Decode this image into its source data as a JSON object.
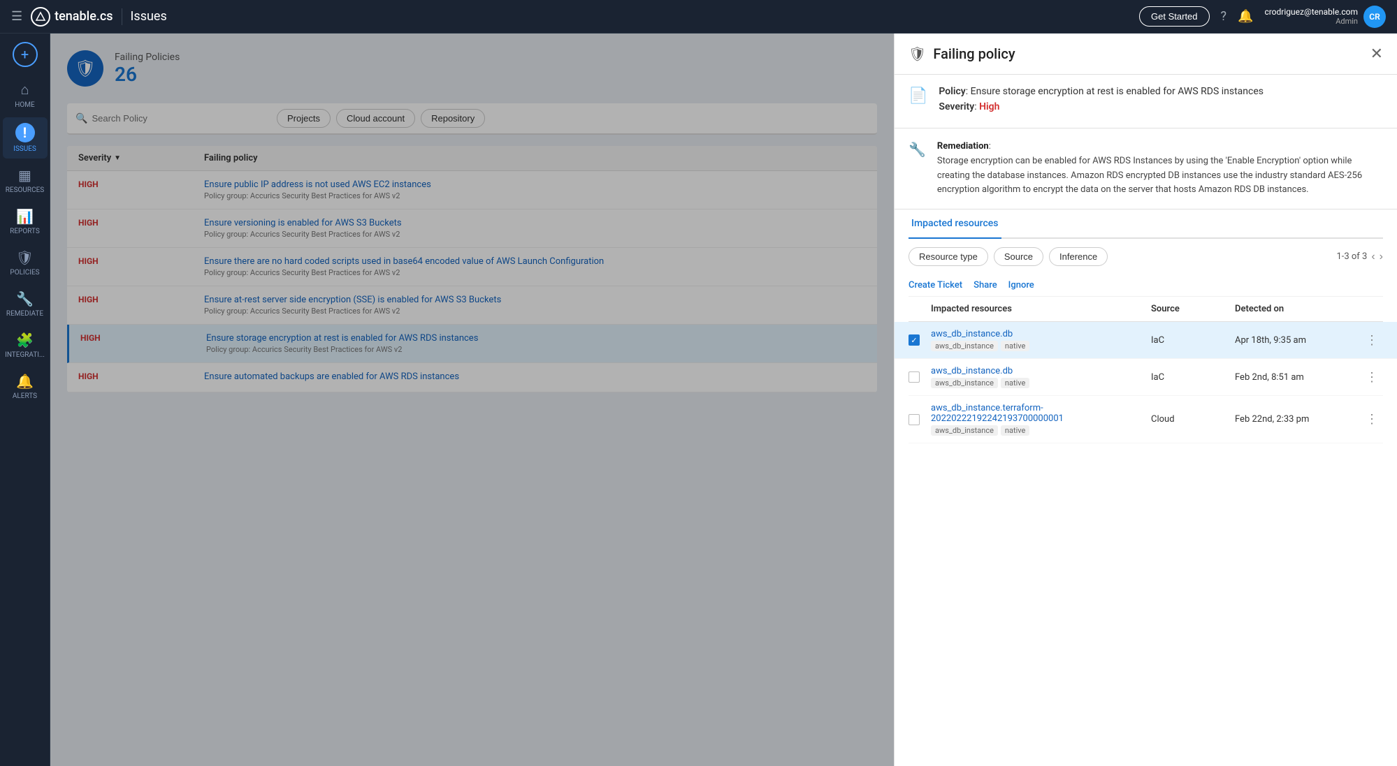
{
  "navbar": {
    "logo_text": "tenable.cs",
    "page_title": "Issues",
    "get_started": "Get Started",
    "user_email": "crodriguez@tenable.com",
    "user_role": "Admin",
    "user_initials": "CR"
  },
  "sidebar": {
    "add_icon": "+",
    "items": [
      {
        "id": "home",
        "label": "HOME",
        "icon": "⌂"
      },
      {
        "id": "issues",
        "label": "ISSUES",
        "icon": "!",
        "active": true
      },
      {
        "id": "resources",
        "label": "RESOURCES",
        "icon": "▦"
      },
      {
        "id": "reports",
        "label": "REPORTS",
        "icon": "⚙"
      },
      {
        "id": "policies",
        "label": "POLICIES",
        "icon": "🛡"
      },
      {
        "id": "remediate",
        "label": "REMEDIATE",
        "icon": "🔧"
      },
      {
        "id": "integrations",
        "label": "INTEGRATI...",
        "icon": "🧩"
      },
      {
        "id": "alerts",
        "label": "ALERTS",
        "icon": "🔔"
      }
    ]
  },
  "issues_page": {
    "header": {
      "title": "Failing Policies",
      "count": "26"
    },
    "search_placeholder": "Search Policy",
    "filters": [
      "Projects",
      "Cloud account",
      "Repository"
    ],
    "table": {
      "columns": [
        "Severity",
        "Failing policy"
      ],
      "rows": [
        {
          "severity": "HIGH",
          "policy_name": "Ensure public IP address is not used AWS EC2 instances",
          "policy_group": "Policy group: Accurics Security Best Practices for AWS v2",
          "selected": false
        },
        {
          "severity": "HIGH",
          "policy_name": "Ensure versioning is enabled for AWS S3 Buckets",
          "policy_group": "Policy group: Accurics Security Best Practices for AWS v2",
          "selected": false
        },
        {
          "severity": "HIGH",
          "policy_name": "Ensure there are no hard coded scripts used in base64 encoded value of AWS Launch Configuration",
          "policy_group": "Policy group: Accurics Security Best Practices for AWS v2",
          "selected": false
        },
        {
          "severity": "HIGH",
          "policy_name": "Ensure at-rest server side encryption (SSE) is enabled for AWS S3 Buckets",
          "policy_group": "Policy group: Accurics Security Best Practices for AWS v2",
          "selected": false
        },
        {
          "severity": "HIGH",
          "policy_name": "Ensure storage encryption at rest is enabled for AWS RDS instances",
          "policy_group": "Policy group: Accurics Security Best Practices for AWS v2",
          "selected": true
        },
        {
          "severity": "HIGH",
          "policy_name": "Ensure automated backups are enabled for AWS RDS instances",
          "policy_group": "",
          "selected": false
        }
      ]
    }
  },
  "right_panel": {
    "title": "Failing policy",
    "policy_label": "Policy",
    "policy_text": "Ensure storage encryption at rest is enabled for AWS RDS instances",
    "severity_label": "Severity",
    "severity_value": "High",
    "remediation_title": "Remediation",
    "remediation_body": "Storage encryption can be enabled for AWS RDS Instances by using the 'Enable Encryption' option while creating the database instances. Amazon RDS encrypted DB instances use the industry standard AES-256 encryption algorithm to encrypt the data on the server that hosts Amazon RDS DB instances.",
    "tabs": [
      {
        "id": "impacted",
        "label": "Impacted resources",
        "active": true
      }
    ],
    "filter_buttons": [
      "Resource type",
      "Source",
      "Inference"
    ],
    "pagination": "1-3 of 3",
    "action_links": [
      "Create Ticket",
      "Share",
      "Ignore"
    ],
    "table": {
      "columns": [
        "",
        "Impacted resources",
        "Source",
        "Detected on",
        ""
      ],
      "rows": [
        {
          "checked": true,
          "resource_link": "aws_db_instance.db",
          "tags": [
            "aws_db_instance",
            "native"
          ],
          "source": "IaC",
          "detected_on": "Apr 18th, 9:35 am",
          "highlighted": true
        },
        {
          "checked": false,
          "resource_link": "aws_db_instance.db",
          "tags": [
            "aws_db_instance",
            "native"
          ],
          "source": "IaC",
          "detected_on": "Feb 2nd, 8:51 am",
          "highlighted": false
        },
        {
          "checked": false,
          "resource_link": "aws_db_instance.terraform-20220222192242193700000001",
          "tags": [
            "aws_db_instance",
            "native"
          ],
          "source": "Cloud",
          "detected_on": "Feb 22nd, 2:33 pm",
          "highlighted": false
        }
      ]
    }
  }
}
